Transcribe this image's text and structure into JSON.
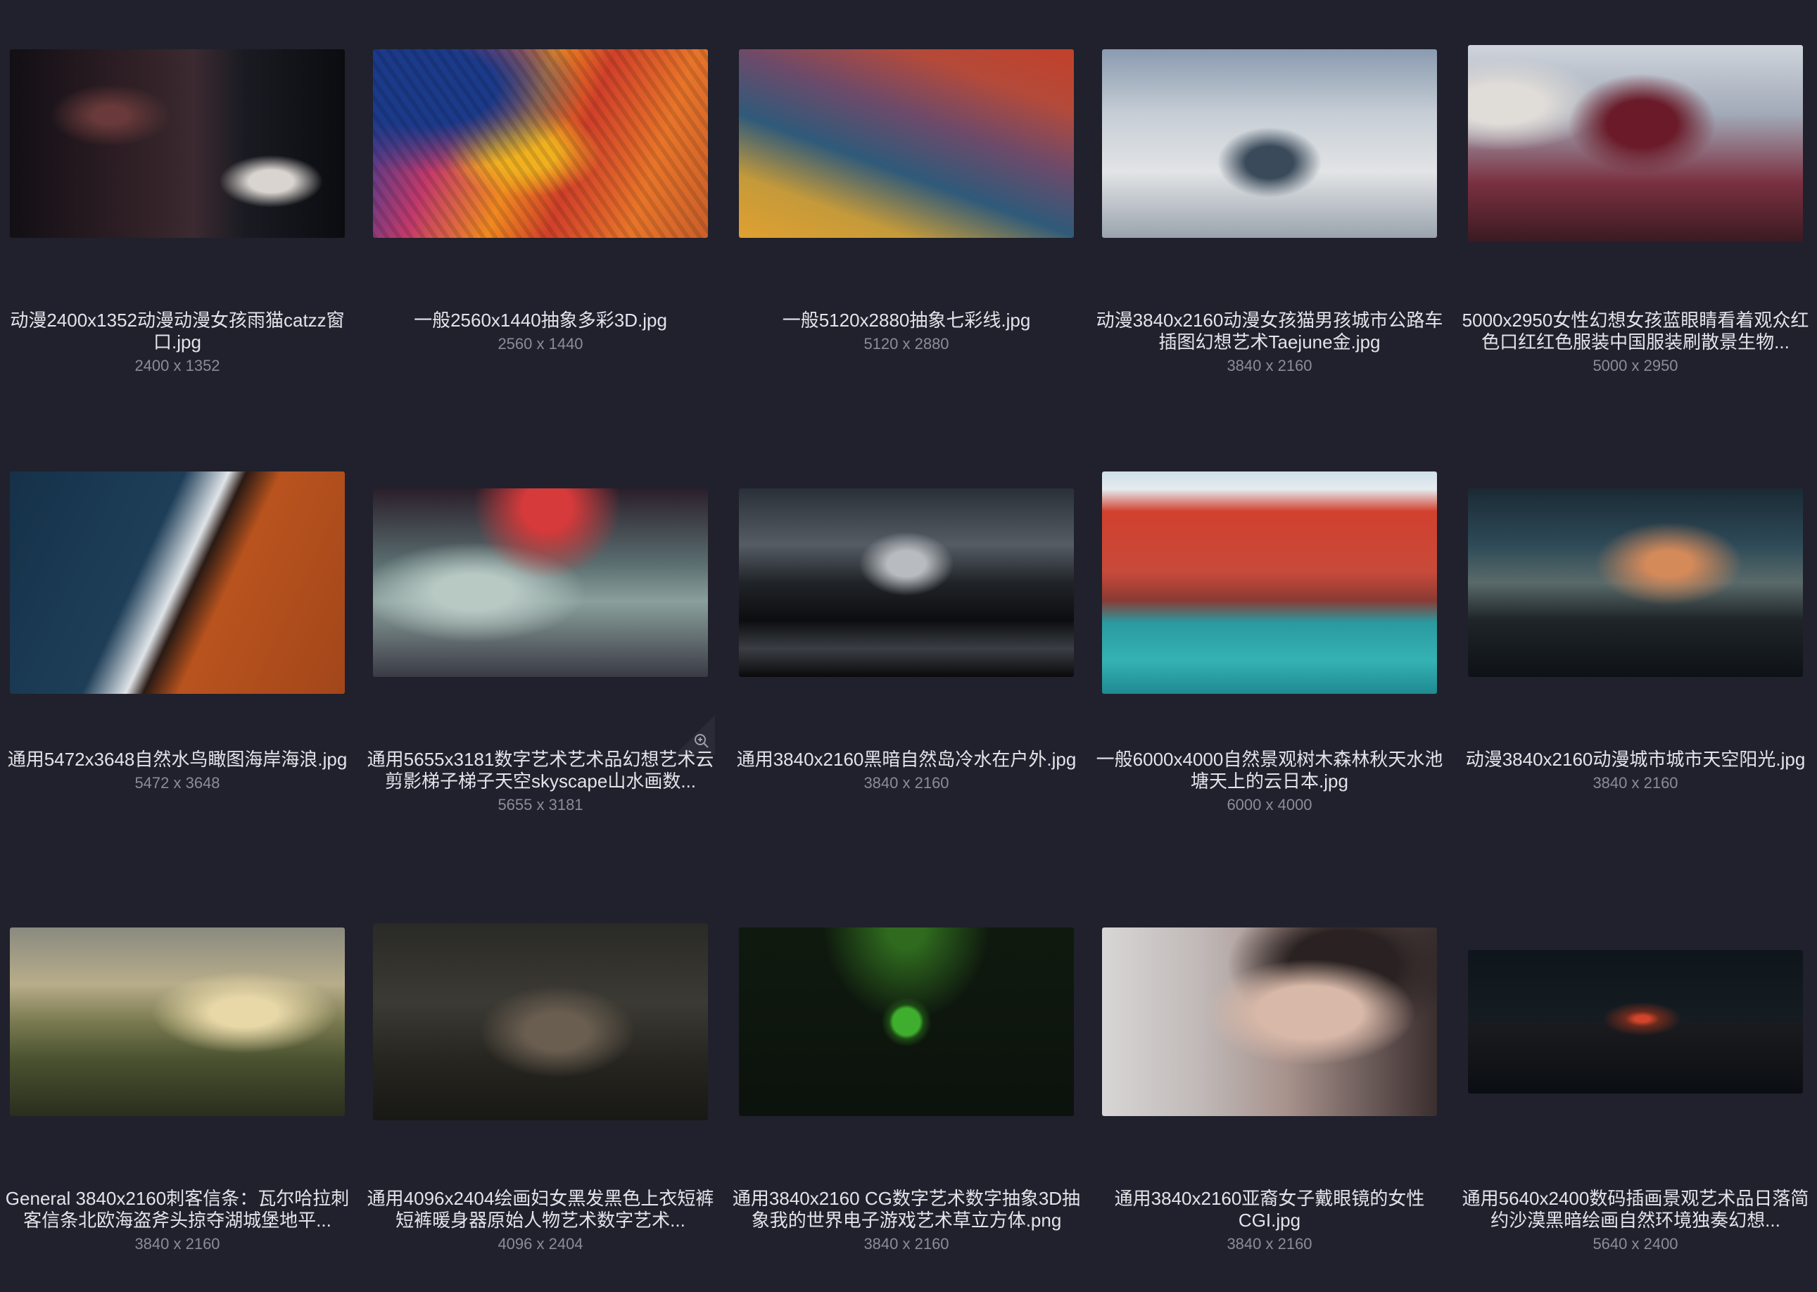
{
  "gallery": {
    "items": [
      {
        "name": "动漫2400x1352动漫动漫女孩雨猫catzz窗口.jpg",
        "dims": "2400 x 1352"
      },
      {
        "name": "一般2560x1440抽象多彩3D.jpg",
        "dims": "2560 x 1440"
      },
      {
        "name": "一般5120x2880抽象七彩线.jpg",
        "dims": "5120 x 2880"
      },
      {
        "name": "动漫3840x2160动漫女孩猫男孩城市公路车插图幻想艺术Taejune金.jpg",
        "dims": "3840 x 2160"
      },
      {
        "name": "5000x2950女性幻想女孩蓝眼睛看着观众红色口红红色服装中国服装刷散景生物...",
        "dims": "5000 x 2950"
      },
      {
        "name": "通用5472x3648自然水鸟瞰图海岸海浪.jpg",
        "dims": "5472 x 3648"
      },
      {
        "name": "通用5655x3181数字艺术艺术品幻想艺术云剪影梯子梯子天空skyscape山水画数...",
        "dims": "5655 x 3181"
      },
      {
        "name": "通用3840x2160黑暗自然岛冷水在户外.jpg",
        "dims": "3840 x 2160"
      },
      {
        "name": "一般6000x4000自然景观树木森林秋天水池塘天上的云日本.jpg",
        "dims": "6000 x 4000"
      },
      {
        "name": "动漫3840x2160动漫城市城市天空阳光.jpg",
        "dims": "3840 x 2160"
      },
      {
        "name": "General 3840x2160刺客信条：瓦尔哈拉刺客信条北欧海盗斧头掠夺湖城堡地平...",
        "dims": "3840 x 2160"
      },
      {
        "name": "通用4096x2404绘画妇女黑发黑色上衣短裤短裤暖身器原始人物艺术数字艺术...",
        "dims": "4096 x 2404"
      },
      {
        "name": "通用3840x2160 CG数字艺术数字抽象3D抽象我的世界电子游戏艺术草立方体.png",
        "dims": "3840 x 2160"
      },
      {
        "name": "通用3840x2160亚裔女子戴眼镜的女性CGI.jpg",
        "dims": "3840 x 2160"
      },
      {
        "name": "通用5640x2400数码插画景观艺术品日落简约沙漠黑暗绘画自然环境独奏幻想...",
        "dims": "5640 x 2400"
      }
    ]
  }
}
